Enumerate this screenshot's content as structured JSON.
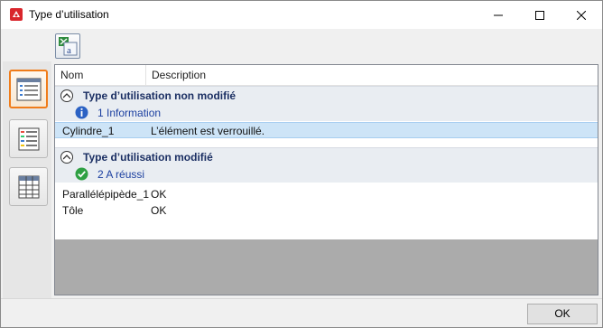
{
  "window": {
    "title": "Type d’utilisation",
    "icon": "app-red-icon"
  },
  "toolbar": {
    "export_icon": "excel-export-icon"
  },
  "sidebar": {
    "items": [
      {
        "icon": "list-view-icon",
        "active": true
      },
      {
        "icon": "colored-list-view-icon",
        "active": false
      },
      {
        "icon": "table-view-icon",
        "active": false
      }
    ]
  },
  "grid": {
    "columns": [
      "Nom",
      "Description"
    ],
    "groups": [
      {
        "title": "Type d’utilisation non modifié",
        "status": {
          "icon": "info-icon",
          "label": "1 Information"
        },
        "rows": [
          {
            "name": "Cylindre_1",
            "description": "L’élément est verrouillé.",
            "selected": true
          }
        ]
      },
      {
        "title": "Type d’utilisation modifié",
        "status": {
          "icon": "success-check-icon",
          "label": "2 A réussi"
        },
        "rows": [
          {
            "name": "Parallélépipède_1",
            "description": "OK",
            "selected": false
          },
          {
            "name": "Tôle",
            "description": "OK",
            "selected": false
          }
        ]
      }
    ]
  },
  "footer": {
    "ok_label": "OK"
  },
  "colors": {
    "accent_active": "#f07c1a",
    "group_text": "#1b2f63",
    "status_text": "#1b3fa0",
    "selected_row": "#cde4f7"
  }
}
